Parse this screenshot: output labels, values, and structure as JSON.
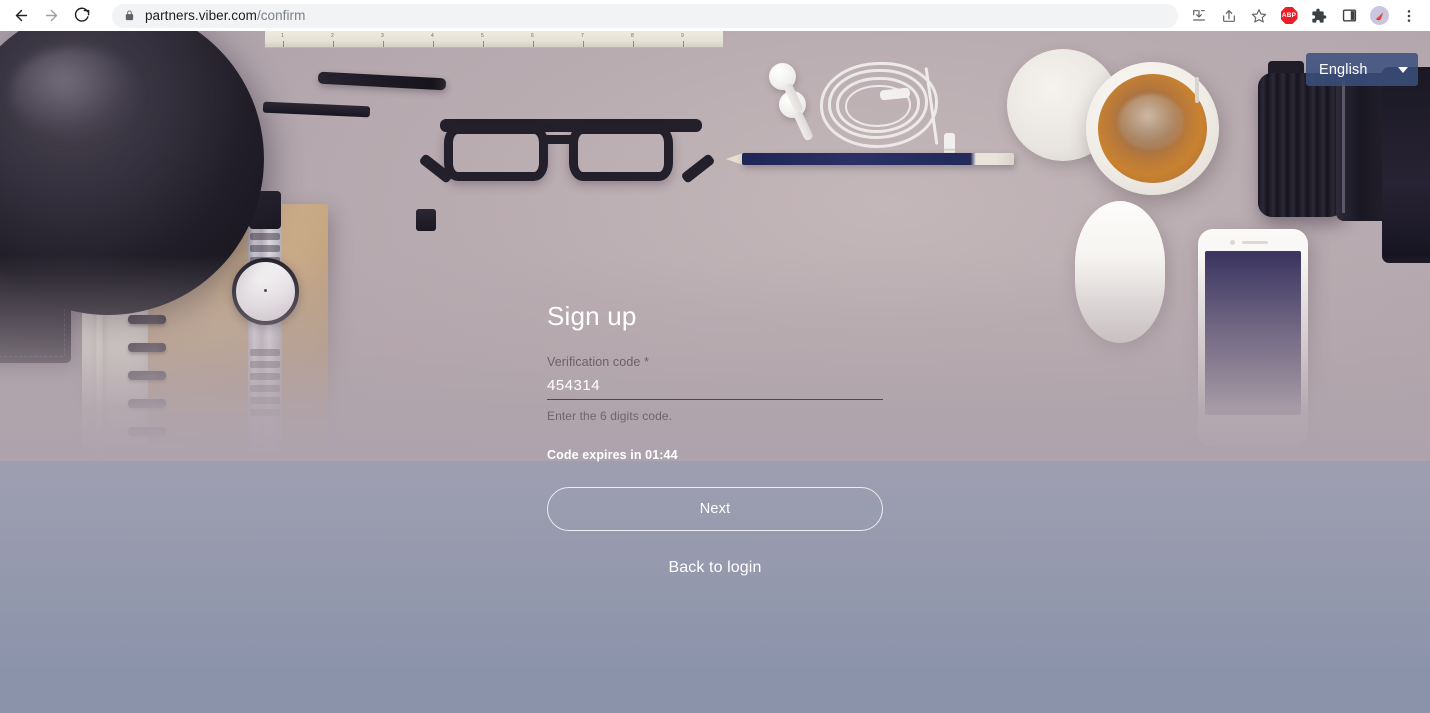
{
  "browser": {
    "back_icon": "back-arrow-icon",
    "forward_icon": "forward-arrow-icon",
    "reload_icon": "reload-icon",
    "lock_icon": "lock-icon",
    "url_host": "partners.viber.com",
    "url_path": "/confirm",
    "toolbar": {
      "install_icon": "install-app-icon",
      "share_icon": "share-icon",
      "bookmark_icon": "bookmark-star-icon",
      "adblock_label": "ABP",
      "extensions_icon": "extensions-puzzle-icon",
      "side_panel_icon": "side-panel-icon",
      "profile_icon": "profile-avatar-icon",
      "menu_icon": "three-dot-menu-icon"
    }
  },
  "language": {
    "selected": "English",
    "caret_icon": "chevron-down-icon"
  },
  "form": {
    "title": "Sign up",
    "field_label": "Verification code *",
    "field_value": "454314",
    "field_placeholder": "",
    "field_hint": "Enter the 6 digits code.",
    "expires_text": "Code expires in 01:44",
    "next_label": "Next",
    "back_label": "Back to login"
  },
  "theme": {
    "accent_blue": "#3a4f7d",
    "text_white": "#ffffff",
    "muted_text": "#6b6167",
    "bg_top": "#b4a6ab",
    "bg_bottom": "#8b93ab",
    "adblock_red": "#eb1d26"
  }
}
